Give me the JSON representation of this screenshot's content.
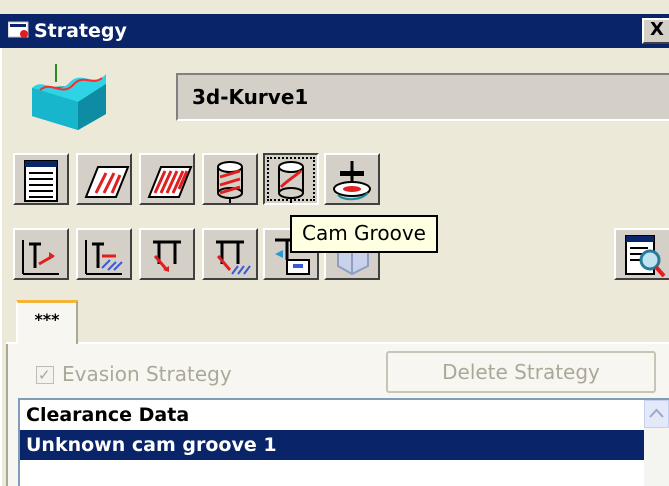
{
  "window": {
    "title": "Strategy",
    "close_label": "X"
  },
  "strategy_name": "3d-Kurve1",
  "toolbar_row1": [
    {
      "icon": "list-document-icon"
    },
    {
      "icon": "flat-surface-icon"
    },
    {
      "icon": "hatched-surface-icon"
    },
    {
      "icon": "cylinder-groove-icon"
    },
    {
      "icon": "cam-groove-icon",
      "pressed": true
    },
    {
      "icon": "rotary-tool-icon"
    }
  ],
  "toolbar_row2": [
    {
      "icon": "tool-approach-icon"
    },
    {
      "icon": "tool-approach-hatched-icon"
    },
    {
      "icon": "t-tool-icon"
    },
    {
      "icon": "t-tool-hatched-icon"
    },
    {
      "icon": "tool-clamp-icon"
    },
    {
      "icon": "cube-icon"
    }
  ],
  "tooltip": "Cam Groove",
  "tab_label": "***",
  "evasion_strategy_label": "Evasion Strategy",
  "evasion_checked": true,
  "delete_button_label": "Delete Strategy",
  "list_items": [
    {
      "label": "Clearance Data",
      "selected": false
    },
    {
      "label": "Unknown cam groove 1",
      "selected": true
    }
  ],
  "colors": {
    "titlebar": "#0a246a",
    "selection": "#0a246a",
    "tab_accent": "#f4b43a",
    "tooltip_bg": "#ffffe1"
  }
}
